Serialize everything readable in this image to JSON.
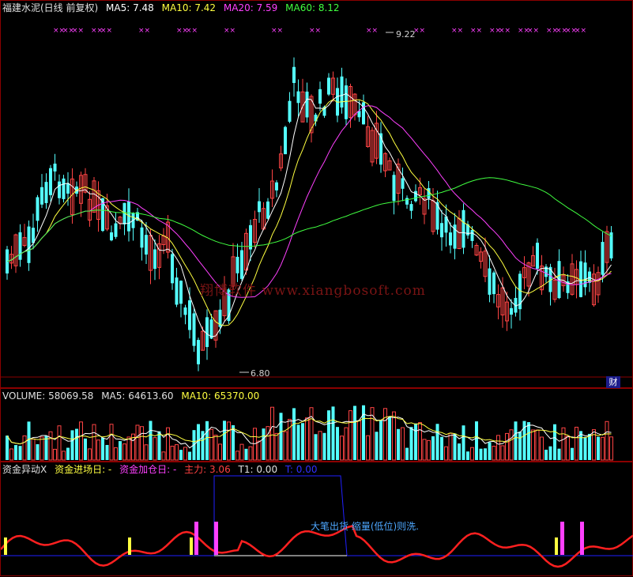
{
  "main": {
    "title": "福建水泥(日线 前复权)",
    "ma5_label": "MA5: 7.48",
    "ma10_label": "MA10: 7.42",
    "ma20_label": "MA20: 7.59",
    "ma60_label": "MA60: 8.12",
    "high_label": "9.22",
    "low_label": "6.80",
    "watermark": "翔博软件 www.xiangbosoft.com",
    "fin_button": "财",
    "colors": {
      "up": "#ff4444",
      "down": "#54ffff",
      "ma5": "#ffffff",
      "ma10": "#ffff40",
      "ma20": "#ff40ff",
      "ma60": "#40ff40",
      "grid": "#8b0000"
    }
  },
  "volume": {
    "volume_label": "VOLUME: 58069.58",
    "ma5_label": "MA5: 64613.60",
    "ma10_label": "MA10: 65370.00"
  },
  "indicator": {
    "name": "资金异动X",
    "entry_label": "资金进场日: -",
    "add_label": "资金加仓日: -",
    "main_label": "主力: 3.06",
    "t1_label": "T1: 0.00",
    "t_label": "T: 0.00",
    "note": "大笔出货 缩量(低位)则洗."
  }
}
